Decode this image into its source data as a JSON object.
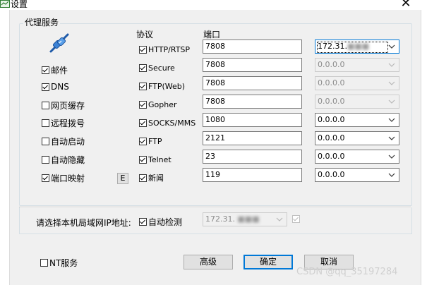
{
  "window": {
    "title": "设置",
    "close_glyph": "✕"
  },
  "proxy": {
    "group_label": "代理服务",
    "left_options": [
      {
        "label": "邮件",
        "checked": true
      },
      {
        "label": "DNS",
        "checked": true
      },
      {
        "label": "网页缓存",
        "checked": false
      },
      {
        "label": "远程拨号",
        "checked": false
      },
      {
        "label": "自动启动",
        "checked": false
      },
      {
        "label": "自动隐藏",
        "checked": false
      },
      {
        "label": "端口映射",
        "checked": true
      }
    ],
    "port_map_button": "E",
    "protocol_header": "协议",
    "port_header": "端口",
    "protocols": [
      {
        "label": "HTTP/RTSP",
        "checked": true,
        "port": "7808",
        "address": "172.31.",
        "enabled": true,
        "selected": true
      },
      {
        "label": "Secure",
        "checked": true,
        "port": "7808",
        "address": "0.0.0.0",
        "enabled": false
      },
      {
        "label": "FTP(Web)",
        "checked": true,
        "port": "7808",
        "address": "0.0.0.0",
        "enabled": false
      },
      {
        "label": "Gopher",
        "checked": true,
        "port": "7808",
        "address": "0.0.0.0",
        "enabled": false
      },
      {
        "label": "SOCKS/MMS",
        "checked": true,
        "port": "1080",
        "address": "0.0.0.0",
        "enabled": true
      },
      {
        "label": "FTP",
        "checked": true,
        "port": "2121",
        "address": "0.0.0.0",
        "enabled": true
      },
      {
        "label": "Telnet",
        "checked": true,
        "port": "23",
        "address": "0.0.0.0",
        "enabled": true
      },
      {
        "label": "新闻",
        "checked": true,
        "port": "119",
        "address": "0.0.0.0",
        "enabled": true
      }
    ]
  },
  "lan": {
    "label": "请选择本机局域网IP地址:",
    "auto_detect_label": "自动检测",
    "auto_detect_checked": true,
    "ip_value": "172.31."
  },
  "footer": {
    "nt_service_label": "NT服务",
    "nt_service_checked": false,
    "advanced_button": "高级",
    "ok_button": "确定",
    "cancel_button": "取消"
  },
  "watermark": "CSDN @qq_35197284"
}
